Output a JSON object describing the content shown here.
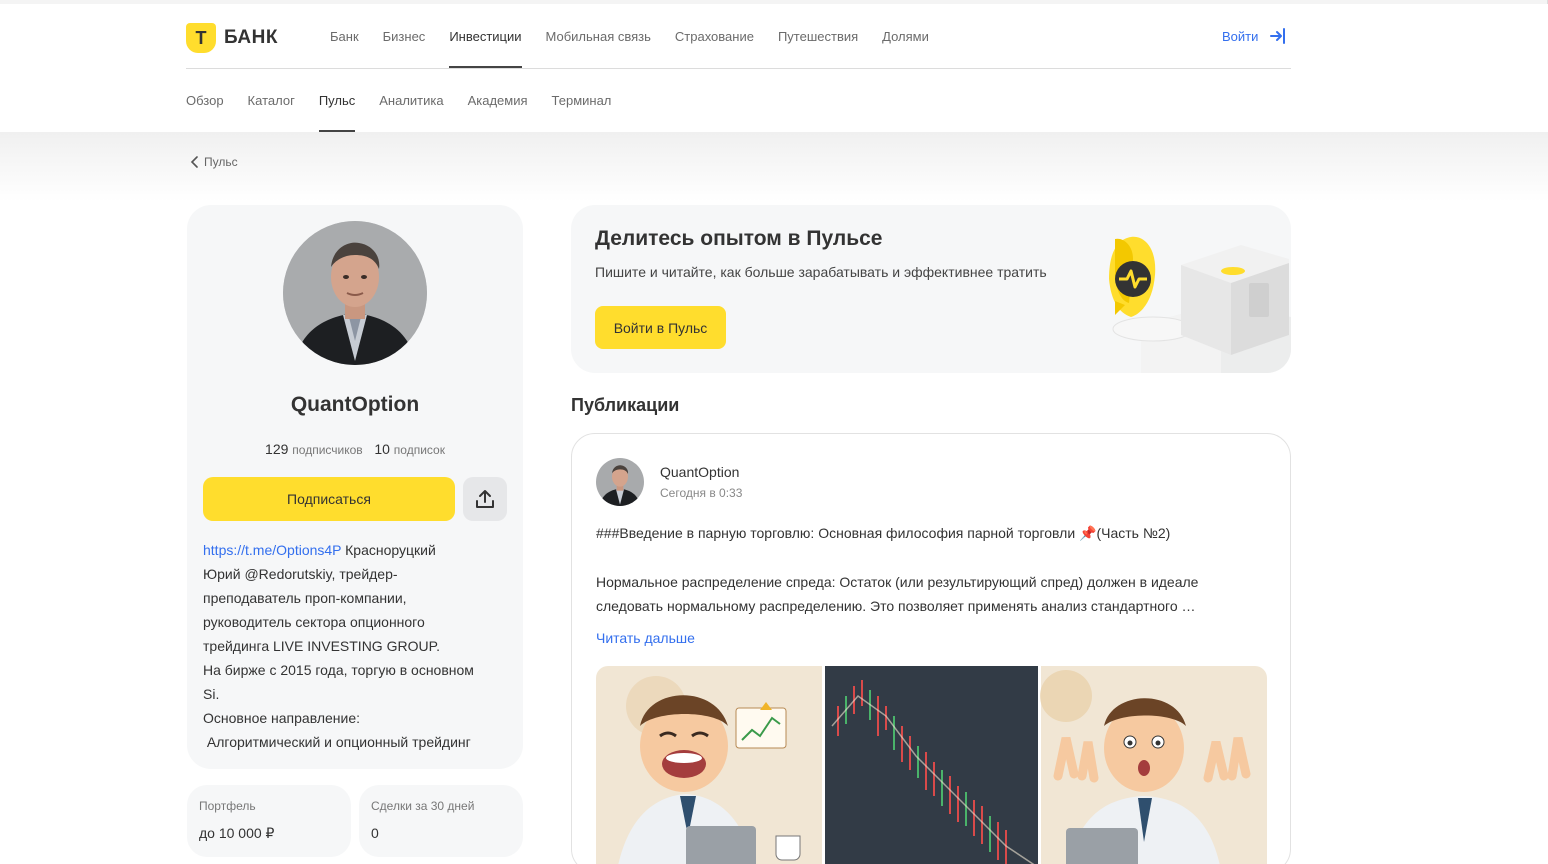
{
  "header": {
    "logo_letter": "Т",
    "logo_text": "БАНК",
    "main_nav": [
      "Банк",
      "Бизнес",
      "Инвестиции",
      "Мобильная связь",
      "Страхование",
      "Путешествия",
      "Долями"
    ],
    "login": "Войти",
    "sub_nav": [
      "Обзор",
      "Каталог",
      "Пульс",
      "Аналитика",
      "Академия",
      "Терминал"
    ]
  },
  "breadcrumb": {
    "back_label": "Пульс"
  },
  "profile": {
    "name": "QuantOption",
    "subscribers_count": "129",
    "subscribers_label": "подписчиков",
    "subscriptions_count": "10",
    "subscriptions_label": "подписок",
    "subscribe_label": "Подписаться",
    "bio_link": "https://t.me/Options4P",
    "bio_lines": [
      " Красноруцкий",
      "Юрий @Redorutskiy, трейдер-",
      "преподаватель проп-компании,",
      "руководитель сектора опционного",
      "трейдинга LIVE INVESTING GROUP.",
      "На  бирже с 2015 года, торгую в основном",
      "Si.",
      "Основное направление:",
      " Алгоритмический и опционный трейдинг"
    ],
    "portfolio_label": "Портфель",
    "portfolio_value": "до 10 000 ₽",
    "deals_label": "Сделки за 30 дней",
    "deals_value": "0"
  },
  "promo": {
    "title": "Делитесь опытом в Пульсе",
    "text": "Пишите и читайте, как больше зарабатывать и эффективнее тратить",
    "button": "Войти в Пульс"
  },
  "publications": {
    "title": "Публикации",
    "post": {
      "author": "QuantOption",
      "time": "Сегодня в 0:33",
      "headline": "###Введение в парную торговлю: Основная философия парной торговли 📌(Часть №2)",
      "body": "Нормальное распределение спреда: Остаток (или результирующий спред) должен в идеале следовать нормальному распределению. Это позволяет применять анализ стандартного …",
      "read_more": "Читать дальше"
    }
  },
  "colors": {
    "accent": "#ffdd2d",
    "link": "#336fee",
    "card_bg": "#f6f7f8"
  }
}
